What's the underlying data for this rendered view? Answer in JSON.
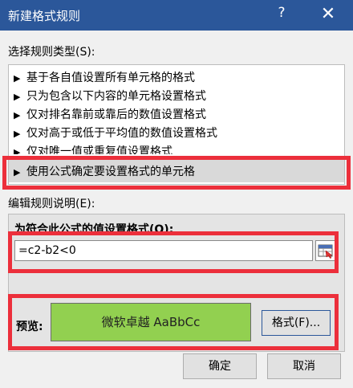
{
  "window": {
    "title": "新建格式规则",
    "help_glyph": "?",
    "close_glyph": "✕"
  },
  "rule_type": {
    "label": "选择规则类型(S):",
    "items": [
      {
        "label": "基于各自值设置所有单元格的格式"
      },
      {
        "label": "只为包含以下内容的单元格设置格式"
      },
      {
        "label": "仅对排名靠前或靠后的数值设置格式"
      },
      {
        "label": "仅对高于或低于平均值的数值设置格式"
      },
      {
        "label": "仅对唯一值或重复值设置格式"
      },
      {
        "label": "使用公式确定要设置格式的单元格",
        "selected": true
      }
    ],
    "arrow_glyph": "▶"
  },
  "edit": {
    "label": "编辑规则说明(E):",
    "formula_label": "为符合此公式的值设置格式(O):",
    "formula_value": "=c2-b2<0"
  },
  "preview": {
    "label": "预览:",
    "sample_text": "微软卓越  AaBbCc",
    "fill_color": "#92d050"
  },
  "buttons": {
    "format": "格式(F)...",
    "ok": "确定",
    "cancel": "取消"
  },
  "colors": {
    "titlebar": "#2b579a",
    "highlight": "#ec2f3b"
  }
}
